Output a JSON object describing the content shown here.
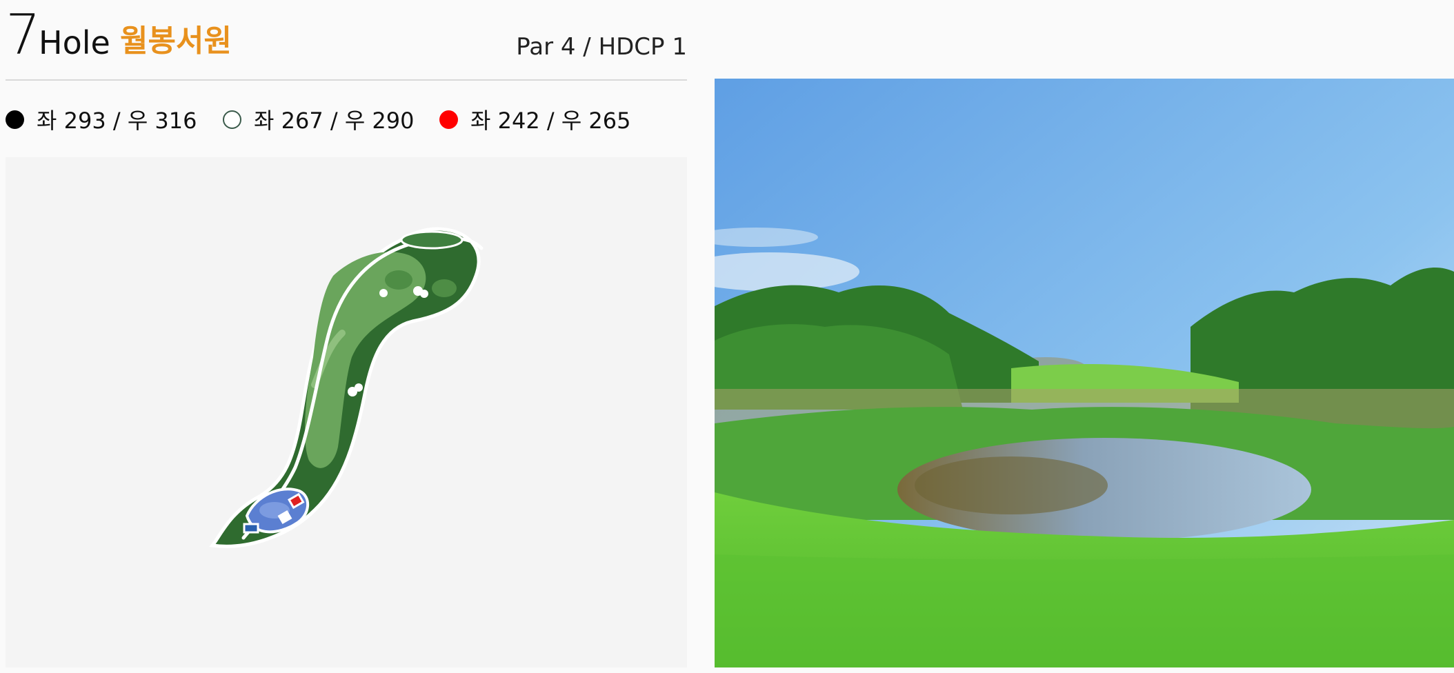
{
  "hole": {
    "number": "7",
    "word": "Hole",
    "name": "월봉서원",
    "par_hdcp": "Par 4 / HDCP 1"
  },
  "tees": [
    {
      "label": "좌 293 / 우 316",
      "color": "#000000",
      "style": "filled"
    },
    {
      "label": "좌 267 / 우 290",
      "color": "#ffffff",
      "style": "outline"
    },
    {
      "label": "좌 242 / 우 265",
      "color": "#ff0000",
      "style": "filled"
    }
  ],
  "colors": {
    "accent": "#e8911d",
    "divider": "#d9d9d9",
    "rough": "#2f6b2f",
    "fairway": "#6aa55c",
    "water": "#5b7fd1"
  }
}
